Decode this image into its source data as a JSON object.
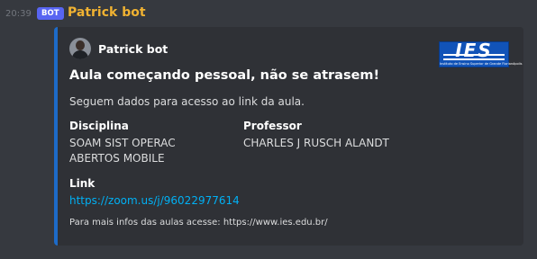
{
  "message": {
    "timestamp": "20:39",
    "bot_tag": "BOT",
    "username": "Patrick bot"
  },
  "embed": {
    "accent_color": "#1d6bc8",
    "author": {
      "name": "Patrick bot",
      "avatar": "user-avatar"
    },
    "thumbnail": {
      "logo_text": "IES",
      "logo_subtext": "Instituto de Ensino Superior de Grande Florianópolis"
    },
    "title": "Aula começando pessoal, não se atrasem!",
    "description": "Seguem dados para acesso ao link da aula.",
    "fields": {
      "disciplina": {
        "name": "Disciplina",
        "value_line1": "SOAM SIST OPERAC",
        "value_line2": "ABERTOS MOBILE"
      },
      "professor": {
        "name": "Professor",
        "value": "CHARLES J RUSCH ALANDT"
      },
      "link": {
        "name": "Link",
        "value": "https://zoom.us/j/96022977614"
      }
    },
    "footer": "Para mais infos das aulas acesse: https://www.ies.edu.br/"
  },
  "colors": {
    "background": "#36393f",
    "embed_background": "#2f3136",
    "username": "#f0b232",
    "bot_tag": "#5865f2",
    "link": "#00b0f4"
  }
}
